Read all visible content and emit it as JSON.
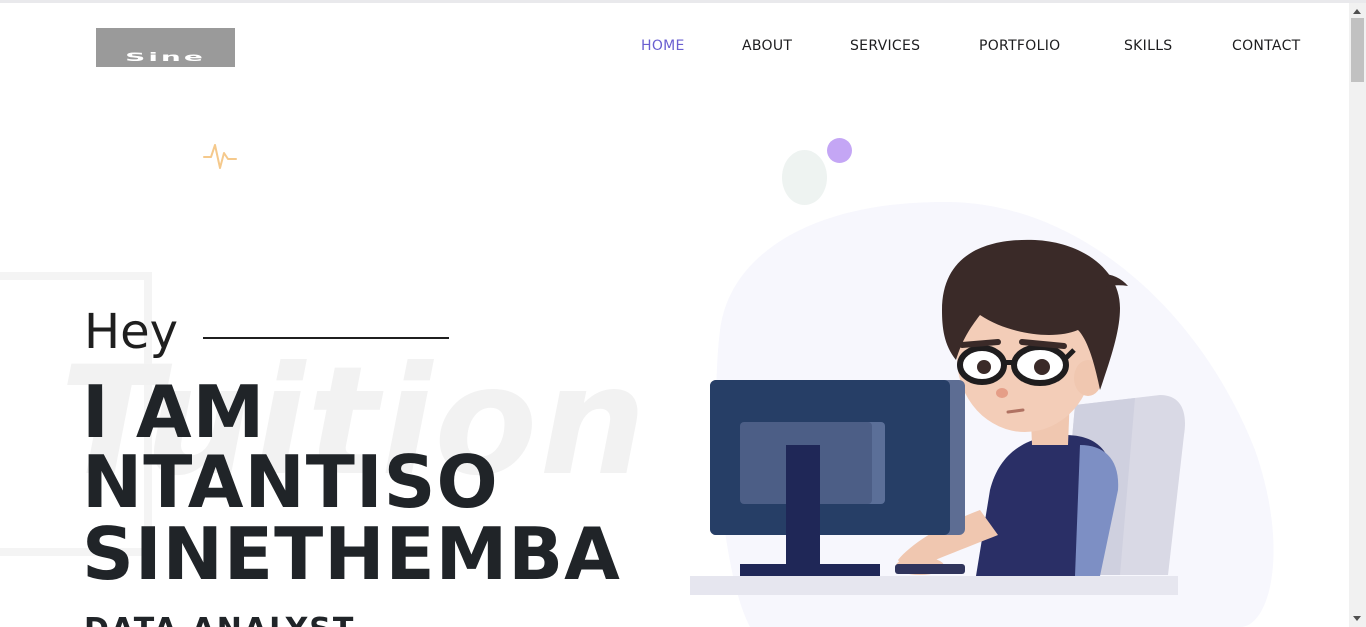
{
  "header": {
    "logo_text": "Sine",
    "nav": [
      {
        "label": "HOME",
        "active": true
      },
      {
        "label": "ABOUT",
        "active": false
      },
      {
        "label": "SERVICES",
        "active": false
      },
      {
        "label": "PORTFOLIO",
        "active": false
      },
      {
        "label": "SKILLS",
        "active": false
      },
      {
        "label": "CONTACT",
        "active": false
      }
    ]
  },
  "hero": {
    "greeting": "Hey",
    "line1": "I AM",
    "line2": "NTANTISO",
    "line3": "SINETHEMBA",
    "subtitle": "DATA ANALYST",
    "watermark": "Tuition"
  },
  "icons": {
    "pulse": "heartbeat-icon",
    "illustration": "developer-at-computer-illustration"
  },
  "colors": {
    "accent": "#6a5fd0",
    "text": "#202428",
    "purple_dot": "#c4a6f5",
    "pulse": "#f5c98c"
  }
}
